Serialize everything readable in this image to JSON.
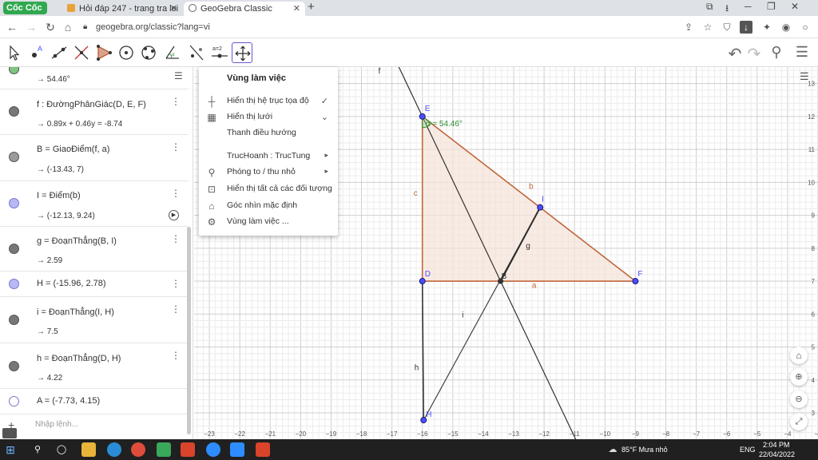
{
  "browser": {
    "logo": "Cốc Cốc",
    "tabs": [
      {
        "label": "Hỏi đáp 247 - trang tra loi"
      },
      {
        "label": "GeoGebra Classic"
      }
    ],
    "url": "geogebra.org/classic?lang=vi"
  },
  "algebra": {
    "rows": [
      {
        "def": "",
        "val": "→ 54.46°",
        "color": "#7fc47f"
      },
      {
        "def": "f : ĐườngPhânGiác(D, E, F)",
        "val": "→ 0.89x + 0.46y = -8.74",
        "color": "#777777"
      },
      {
        "def": "B = GiaoĐiểm(f, a)",
        "val": "→ (-13.43, 7)",
        "color": "#9b9b9b"
      },
      {
        "def": "I = Điểm(b)",
        "val": "→ (-12.13, 9.24)",
        "color": "#b8b8f5"
      },
      {
        "def": "g = ĐoạnThẳng(B, I)",
        "val": "→ 2.59",
        "color": "#777777"
      },
      {
        "def": "H = (-15.96, 2.78)",
        "val": "",
        "color": "#b8b8f5"
      },
      {
        "def": "i = ĐoạnThẳng(I, H)",
        "val": "→ 7.5",
        "color": "#777777"
      },
      {
        "def": "h = ĐoạnThẳng(D, H)",
        "val": "→ 4.22",
        "color": "#777777"
      },
      {
        "def": "A = (-7.73, 4.15)",
        "val": "",
        "color": "#ffffff"
      }
    ],
    "input_placeholder": "Nhập lệnh..."
  },
  "menu": {
    "title": "Vùng làm việc",
    "items": [
      {
        "label": "Hiển thị hệ trục tọa độ",
        "icon": "axes-icon",
        "suffix": "✓"
      },
      {
        "label": "Hiển thị lưới",
        "icon": "grid-icon",
        "suffix": "⌄"
      },
      {
        "label": "Thanh điều hướng",
        "icon": "",
        "suffix": ""
      },
      {
        "label": "TrucHoanh : TrucTung",
        "icon": "",
        "suffix": "▸"
      },
      {
        "label": "Phóng to / thu nhỏ",
        "icon": "zoom-icon",
        "suffix": "▸"
      },
      {
        "label": "Hiển thị tất cả các đối tượng",
        "icon": "show-all-icon",
        "suffix": ""
      },
      {
        "label": "Góc nhìn mặc định",
        "icon": "home-icon",
        "suffix": ""
      },
      {
        "label": "Vùng làm việc ...",
        "icon": "gear-icon",
        "suffix": ""
      }
    ]
  },
  "graphics": {
    "angle_label": "α = 54.46°",
    "point_labels": {
      "E": "E",
      "D": "D",
      "F": "F",
      "B": "B",
      "I": "I",
      "H": "H"
    },
    "object_labels": {
      "f": "f",
      "c": "c",
      "b": "b",
      "g": "g",
      "a": "a",
      "i": "i",
      "h": "h"
    },
    "x_ticks": [
      "-23",
      "-22",
      "-21",
      "-20",
      "-19",
      "-18",
      "-17",
      "-16",
      "-15",
      "-14",
      "-13",
      "-12",
      "-11",
      "-10",
      "-9",
      "-8",
      "-7",
      "-6",
      "-5",
      "-4",
      "-3"
    ],
    "y_ticks": [
      "13",
      "12",
      "11",
      "10",
      "9",
      "8",
      "7",
      "6",
      "5",
      "4",
      "3"
    ],
    "x_min": -23.5,
    "x_max": -3,
    "y_min": 2.2,
    "y_max": 13.5,
    "points": {
      "D": [
        -16,
        7
      ],
      "E": [
        -16,
        12
      ],
      "F": [
        -9,
        7
      ],
      "B": [
        -13.43,
        7
      ],
      "I": [
        -12.13,
        9.24
      ],
      "H": [
        -15.96,
        2.78
      ]
    },
    "colors": {
      "triangle": "#c0663b",
      "fill": "#f5e3d9",
      "point": "#4d4dff",
      "line": "#333333",
      "angle": "#2e8b2e"
    }
  },
  "taskbar": {
    "weather": "85°F  Mưa nhỏ",
    "lang": "ENG",
    "time": "2:04 PM",
    "date": "22/04/2022"
  }
}
